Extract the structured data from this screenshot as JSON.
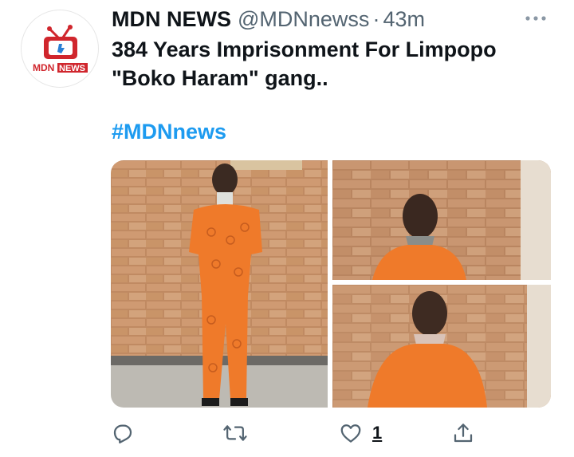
{
  "tweet": {
    "author_name": "MDN NEWS",
    "handle": "@MDNnewss",
    "separator": "·",
    "time": "43m",
    "text_line1": "384 Years Imprisonment For Limpopo",
    "text_line2": "\"Boko Haram\" gang..",
    "hashtag": "#MDNnews"
  },
  "avatar": {
    "logo_text_a": "MDN",
    "logo_text_b": "NEWS"
  },
  "actions": {
    "like_count": "1"
  },
  "colors": {
    "accent": "#1d9bf0",
    "text": "#0f1419",
    "secondary": "#536471",
    "logo_red": "#d0262d",
    "prison_orange": "#ef7a2a"
  },
  "icons": [
    "more-icon",
    "reply-icon",
    "retweet-icon",
    "like-icon",
    "share-icon"
  ]
}
